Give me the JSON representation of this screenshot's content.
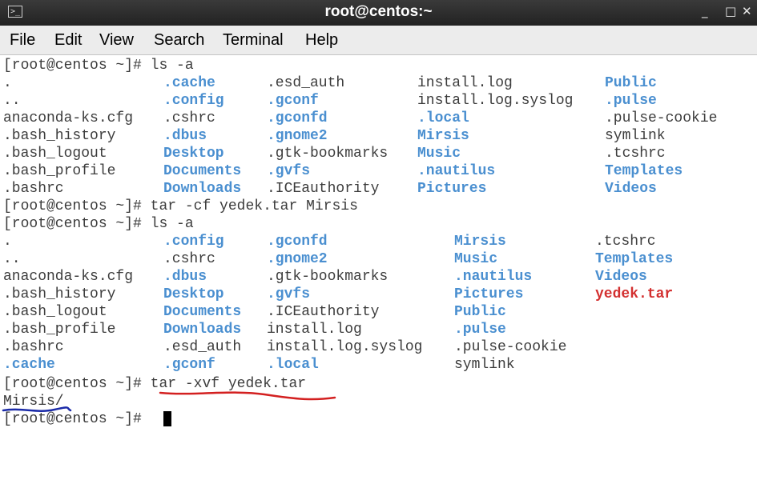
{
  "window": {
    "title": "root@centos:~",
    "icon": "terminal-icon",
    "minimize_glyph": "_",
    "maximize_glyph": "□",
    "close_glyph": "✕"
  },
  "menubar": {
    "items": [
      "File",
      "Edit",
      "View",
      "Search",
      "Terminal",
      "Help"
    ]
  },
  "colors": {
    "directory": "#4a8fd0",
    "archive": "#d33030",
    "text": "#3c3c3c",
    "underline_red": "#d32020",
    "underline_blue": "#1a2aa8"
  },
  "terminal": {
    "prompt": "[root@centos ~]#",
    "commands": [
      "ls -a",
      "tar -cf yedek.tar Mirsis",
      "ls -a",
      "tar -xvf yedek.tar",
      ""
    ],
    "listing1": [
      [
        ".",
        ".cache",
        ".esd_auth",
        "install.log",
        "Public"
      ],
      [
        "..",
        ".config",
        ".gconf",
        "install.log.syslog",
        ".pulse"
      ],
      [
        "anaconda-ks.cfg",
        ".cshrc",
        ".gconfd",
        ".local",
        ".pulse-cookie"
      ],
      [
        ".bash_history",
        ".dbus",
        ".gnome2",
        "Mirsis",
        "symlink"
      ],
      [
        ".bash_logout",
        "Desktop",
        ".gtk-bookmarks",
        "Music",
        ".tcshrc"
      ],
      [
        ".bash_profile",
        "Documents",
        ".gvfs",
        ".nautilus",
        "Templates"
      ],
      [
        ".bashrc",
        "Downloads",
        ".ICEauthority",
        "Pictures",
        "Videos"
      ]
    ],
    "listing2": [
      [
        ".",
        ".config",
        ".gconfd",
        "Mirsis",
        ".tcshrc"
      ],
      [
        "..",
        ".cshrc",
        ".gnome2",
        "Music",
        "Templates"
      ],
      [
        "anaconda-ks.cfg",
        ".dbus",
        ".gtk-bookmarks",
        ".nautilus",
        "Videos"
      ],
      [
        ".bash_history",
        "Desktop",
        ".gvfs",
        "Pictures",
        "yedek.tar"
      ],
      [
        ".bash_logout",
        "Documents",
        ".ICEauthority",
        "Public",
        ""
      ],
      [
        ".bash_profile",
        "Downloads",
        "install.log",
        ".pulse",
        ""
      ],
      [
        ".bashrc",
        ".esd_auth",
        "install.log.syslog",
        ".pulse-cookie",
        ""
      ],
      [
        ".cache",
        ".gconf",
        ".local",
        "symlink",
        ""
      ]
    ],
    "extract_output": "Mirsis/"
  }
}
